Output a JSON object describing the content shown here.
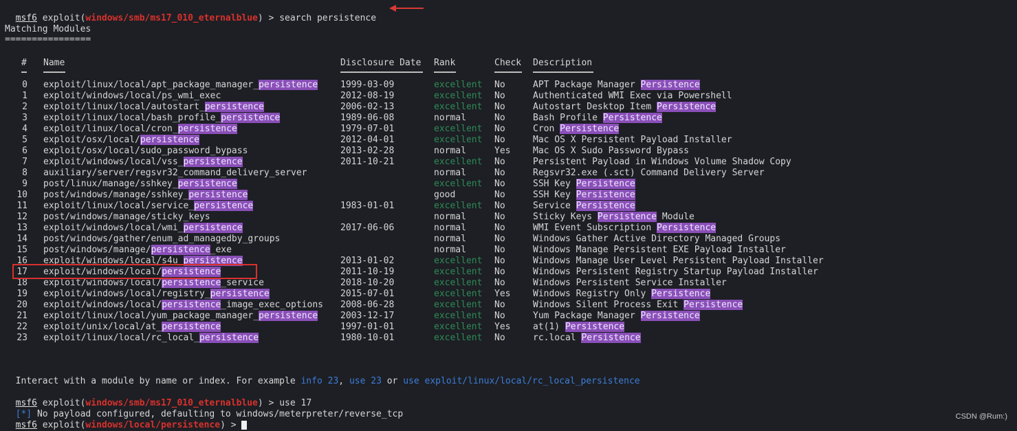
{
  "prompt": {
    "msf": "msf6",
    "exploit_word": "exploit(",
    "module_initial": "windows/smb/ms17_010_eternalblue",
    "close": ") > ",
    "command1": "search persistence",
    "command2": "use 17",
    "module_after": "windows/local/persistence",
    "final_close": ") > "
  },
  "section_title": "Matching Modules",
  "section_rule": "================",
  "headers": {
    "num": "#",
    "name": "Name",
    "date": "Disclosure Date",
    "rank": "Rank",
    "check": "Check",
    "desc": "Description"
  },
  "rows": [
    {
      "num": "0",
      "name": [
        "exploit/linux/local/apt_package_manager_",
        "persistence",
        ""
      ],
      "date": "1999-03-09",
      "rank": "excellent",
      "check": "No",
      "desc": [
        "APT Package Manager ",
        "Persistence",
        ""
      ]
    },
    {
      "num": "1",
      "name": [
        "exploit/windows/local/ps_wmi_exec",
        "",
        ""
      ],
      "date": "2012-08-19",
      "rank": "excellent",
      "check": "No",
      "desc": [
        "Authenticated WMI Exec via Powershell",
        "",
        ""
      ]
    },
    {
      "num": "2",
      "name": [
        "exploit/linux/local/autostart_",
        "persistence",
        ""
      ],
      "date": "2006-02-13",
      "rank": "excellent",
      "check": "No",
      "desc": [
        "Autostart Desktop Item ",
        "Persistence",
        ""
      ]
    },
    {
      "num": "3",
      "name": [
        "exploit/linux/local/bash_profile_",
        "persistence",
        ""
      ],
      "date": "1989-06-08",
      "rank": "normal",
      "check": "No",
      "desc": [
        "Bash Profile ",
        "Persistence",
        ""
      ]
    },
    {
      "num": "4",
      "name": [
        "exploit/linux/local/cron_",
        "persistence",
        ""
      ],
      "date": "1979-07-01",
      "rank": "excellent",
      "check": "No",
      "desc": [
        "Cron ",
        "Persistence",
        ""
      ]
    },
    {
      "num": "5",
      "name": [
        "exploit/osx/local/",
        "persistence",
        ""
      ],
      "date": "2012-04-01",
      "rank": "excellent",
      "check": "No",
      "desc": [
        "Mac OS X Persistent Payload Installer",
        "",
        ""
      ]
    },
    {
      "num": "6",
      "name": [
        "exploit/osx/local/sudo_password_bypass",
        "",
        ""
      ],
      "date": "2013-02-28",
      "rank": "normal",
      "check": "Yes",
      "desc": [
        "Mac OS X Sudo Password Bypass",
        "",
        ""
      ]
    },
    {
      "num": "7",
      "name": [
        "exploit/windows/local/vss_",
        "persistence",
        ""
      ],
      "date": "2011-10-21",
      "rank": "excellent",
      "check": "No",
      "desc": [
        "Persistent Payload in Windows Volume Shadow Copy",
        "",
        ""
      ]
    },
    {
      "num": "8",
      "name": [
        "auxiliary/server/regsvr32_command_delivery_server",
        "",
        ""
      ],
      "date": "",
      "rank": "normal",
      "check": "No",
      "desc": [
        "Regsvr32.exe (.sct) Command Delivery Server",
        "",
        ""
      ]
    },
    {
      "num": "9",
      "name": [
        "post/linux/manage/sshkey_",
        "persistence",
        ""
      ],
      "date": "",
      "rank": "excellent",
      "check": "No",
      "desc": [
        "SSH Key ",
        "Persistence",
        ""
      ]
    },
    {
      "num": "10",
      "name": [
        "post/windows/manage/sshkey_",
        "persistence",
        ""
      ],
      "date": "",
      "rank": "good",
      "check": "No",
      "desc": [
        "SSH Key ",
        "Persistence",
        ""
      ]
    },
    {
      "num": "11",
      "name": [
        "exploit/linux/local/service_",
        "persistence",
        ""
      ],
      "date": "1983-01-01",
      "rank": "excellent",
      "check": "No",
      "desc": [
        "Service ",
        "Persistence",
        ""
      ]
    },
    {
      "num": "12",
      "name": [
        "post/windows/manage/sticky_keys",
        "",
        ""
      ],
      "date": "",
      "rank": "normal",
      "check": "No",
      "desc": [
        "Sticky Keys ",
        "Persistence",
        " Module"
      ]
    },
    {
      "num": "13",
      "name": [
        "exploit/windows/local/wmi_",
        "persistence",
        ""
      ],
      "date": "2017-06-06",
      "rank": "normal",
      "check": "No",
      "desc": [
        "WMI Event Subscription ",
        "Persistence",
        ""
      ]
    },
    {
      "num": "14",
      "name": [
        "post/windows/gather/enum_ad_managedby_groups",
        "",
        ""
      ],
      "date": "",
      "rank": "normal",
      "check": "No",
      "desc": [
        "Windows Gather Active Directory Managed Groups",
        "",
        ""
      ]
    },
    {
      "num": "15",
      "name": [
        "post/windows/manage/",
        "persistence",
        "_exe"
      ],
      "date": "",
      "rank": "normal",
      "check": "No",
      "desc": [
        "Windows Manage Persistent EXE Payload Installer",
        "",
        ""
      ]
    },
    {
      "num": "16",
      "name": [
        "exploit/windows/local/s4u_",
        "persistence",
        ""
      ],
      "date": "2013-01-02",
      "rank": "excellent",
      "check": "No",
      "desc": [
        "Windows Manage User Level Persistent Payload Installer",
        "",
        ""
      ]
    },
    {
      "num": "17",
      "name": [
        "exploit/windows/local/",
        "persistence",
        ""
      ],
      "date": "2011-10-19",
      "rank": "excellent",
      "check": "No",
      "desc": [
        "Windows Persistent Registry Startup Payload Installer",
        "",
        ""
      ]
    },
    {
      "num": "18",
      "name": [
        "exploit/windows/local/",
        "persistence",
        "_service"
      ],
      "date": "2018-10-20",
      "rank": "excellent",
      "check": "No",
      "desc": [
        "Windows Persistent Service Installer",
        "",
        ""
      ]
    },
    {
      "num": "19",
      "name": [
        "exploit/windows/local/registry_",
        "persistence",
        ""
      ],
      "date": "2015-07-01",
      "rank": "excellent",
      "check": "Yes",
      "desc": [
        "Windows Registry Only ",
        "Persistence",
        ""
      ]
    },
    {
      "num": "20",
      "name": [
        "exploit/windows/local/",
        "persistence",
        "_image_exec_options"
      ],
      "date": "2008-06-28",
      "rank": "excellent",
      "check": "No",
      "desc": [
        "Windows Silent Process Exit ",
        "Persistence",
        ""
      ]
    },
    {
      "num": "21",
      "name": [
        "exploit/linux/local/yum_package_manager_",
        "persistence",
        ""
      ],
      "date": "2003-12-17",
      "rank": "excellent",
      "check": "No",
      "desc": [
        "Yum Package Manager ",
        "Persistence",
        ""
      ]
    },
    {
      "num": "22",
      "name": [
        "exploit/unix/local/at_",
        "persistence",
        ""
      ],
      "date": "1997-01-01",
      "rank": "excellent",
      "check": "Yes",
      "desc": [
        "at(1) ",
        "Persistence",
        ""
      ]
    },
    {
      "num": "23",
      "name": [
        "exploit/linux/local/rc_local_",
        "persistence",
        ""
      ],
      "date": "1980-10-01",
      "rank": "excellent",
      "check": "No",
      "desc": [
        "rc.local ",
        "Persistence",
        ""
      ]
    }
  ],
  "interact": {
    "prefix": "Interact with a module by name or index. For example ",
    "ex1": "info 23",
    "sep1": ", ",
    "ex2": "use 23",
    "sep2": " or ",
    "ex3": "use exploit/linux/local/rc_local_persistence"
  },
  "info_line": {
    "marker": "[*]",
    "text": " No payload configured, defaulting to windows/meterpreter/reverse_tcp"
  },
  "watermark": "CSDN @Rum:)",
  "colors": {
    "background": "#1d1f24",
    "highlight": "#8a4fb8",
    "module_red": "#d9312d",
    "rank_green": "#2e8b57",
    "link_blue": "#3d7dd8",
    "annotation_red": "#d93a35"
  }
}
